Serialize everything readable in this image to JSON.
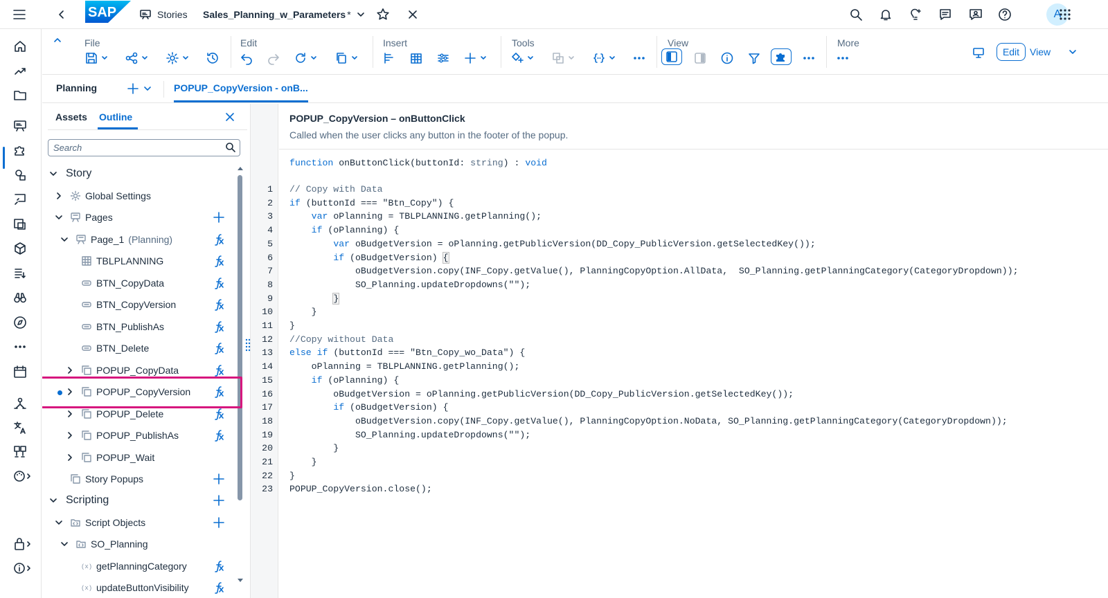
{
  "shell": {
    "back_label": "Stories",
    "story_name": "Sales_Planning_w_Parameters",
    "dirty_marker": "*",
    "avatar_initial": "A",
    "logo_text": "SAP"
  },
  "toolbar": {
    "groups": {
      "file": "File",
      "edit": "Edit",
      "insert": "Insert",
      "tools": "Tools",
      "view": "View",
      "more": "More"
    },
    "edit_button": "Edit",
    "view_button": "View"
  },
  "tabs": {
    "planning": "Planning",
    "active": "POPUP_CopyVersion - onB..."
  },
  "outline": {
    "tab_assets": "Assets",
    "tab_outline": "Outline",
    "search_placeholder": "Search",
    "items": [
      {
        "label": "Story"
      },
      {
        "label": "Global Settings"
      },
      {
        "label": "Pages"
      },
      {
        "label": "Page_1",
        "sub": "(Planning)"
      },
      {
        "label": "TBLPLANNING"
      },
      {
        "label": "BTN_CopyData"
      },
      {
        "label": "BTN_CopyVersion"
      },
      {
        "label": "BTN_PublishAs"
      },
      {
        "label": "BTN_Delete"
      },
      {
        "label": "POPUP_CopyData"
      },
      {
        "label": "POPUP_CopyVersion"
      },
      {
        "label": "POPUP_Delete"
      },
      {
        "label": "POPUP_PublishAs"
      },
      {
        "label": "POPUP_Wait"
      },
      {
        "label": "Story Popups"
      },
      {
        "label": "Scripting"
      },
      {
        "label": "Script Objects"
      },
      {
        "label": "SO_Planning"
      },
      {
        "label": "getPlanningCategory"
      },
      {
        "label": "updateButtonVisibility"
      }
    ]
  },
  "editor": {
    "title": "POPUP_CopyVersion – onButtonClick",
    "description": "Called when the user clicks any button in the footer of the popup.",
    "signature": {
      "kw_function": "function",
      "name": " onButtonClick(buttonId: ",
      "type": "string",
      "close": ") : ",
      "ret": "void"
    },
    "line_numbers": [
      "1",
      "2",
      "3",
      "4",
      "5",
      "6",
      "7",
      "8",
      "9",
      "10",
      "11",
      "12",
      "13",
      "14",
      "15",
      "16",
      "17",
      "18",
      "19",
      "20",
      "21",
      "22",
      "23"
    ],
    "code": {
      "l1": "// Copy with Data",
      "l2a": "if",
      "l2b": " (buttonId === \"Btn_Copy\") {",
      "l3a": "    ",
      "l3b": "var",
      "l3c": " oPlanning = TBLPLANNING.getPlanning();",
      "l4a": "    ",
      "l4b": "if",
      "l4c": " (oPlanning) {",
      "l5a": "        ",
      "l5b": "var",
      "l5c": " oBudgetVersion = oPlanning.getPublicVersion(DD_Copy_PublicVersion.getSelectedKey());",
      "l6a": "        ",
      "l6b": "if",
      "l6c": " (oBudgetVersion) ",
      "l6d": "{",
      "l7": "            oBudgetVersion.copy(INF_Copy.getValue(), PlanningCopyOption.AllData,  SO_Planning.getPlanningCategory(CategoryDropdown));",
      "l8": "            SO_Planning.updateDropdowns(\"\");",
      "l9a": "        ",
      "l9b": "}",
      "l10": "    }",
      "l11": "}",
      "l12": "//Copy without Data",
      "l13a": "else if",
      "l13b": " (buttonId === \"Btn_Copy_wo_Data\") {",
      "l14": "    oPlanning = TBLPLANNING.getPlanning();",
      "l15a": "    ",
      "l15b": "if",
      "l15c": " (oPlanning) {",
      "l16": "        oBudgetVersion = oPlanning.getPublicVersion(DD_Copy_PublicVersion.getSelectedKey());",
      "l17a": "        ",
      "l17b": "if",
      "l17c": " (oBudgetVersion) {",
      "l18": "            oBudgetVersion.copy(INF_Copy.getValue(), PlanningCopyOption.NoData, SO_Planning.getPlanningCategory(CategoryDropdown));",
      "l19": "            SO_Planning.updateDropdowns(\"\");",
      "l20": "        }",
      "l21": "    }",
      "l22": "}",
      "l23": "POPUP_CopyVersion.close();"
    }
  },
  "colors": {
    "accent": "#0a6ed1",
    "highlight_border": "#d6177e",
    "text": "#1d2d3e"
  }
}
